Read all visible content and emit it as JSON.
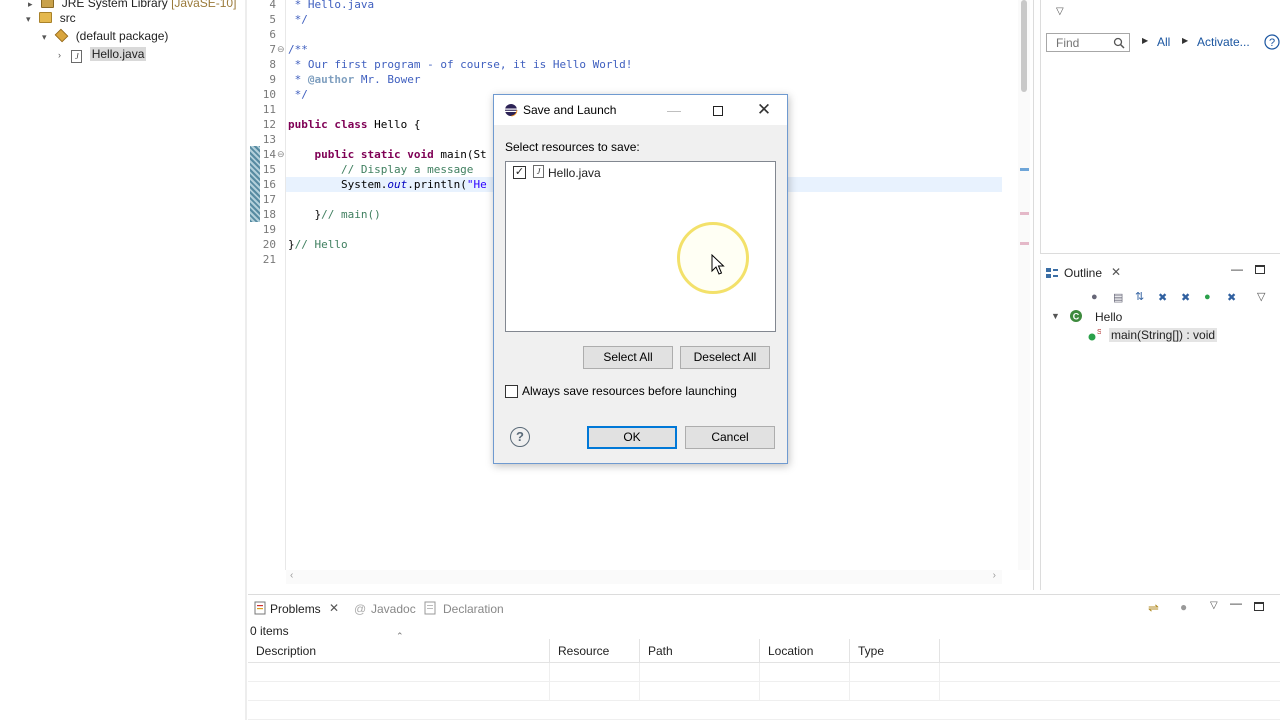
{
  "explorer": {
    "items": [
      {
        "label": "JRE System Library",
        "suffix": "[JavaSE-10]"
      },
      {
        "label": "src"
      },
      {
        "label": "(default package)"
      },
      {
        "label": "Hello.java"
      }
    ]
  },
  "editor": {
    "lines": [
      {
        "n": "4",
        "text": " * Hello.java"
      },
      {
        "n": "5",
        "text": " */"
      },
      {
        "n": "6",
        "text": ""
      },
      {
        "n": "7",
        "text": "/**"
      },
      {
        "n": "8",
        "text": " * Our first program - of course, it is Hello World!"
      },
      {
        "n": "9",
        "text": " * @author Mr. Bower"
      },
      {
        "n": "10",
        "text": " */"
      },
      {
        "n": "11",
        "text": ""
      },
      {
        "n": "12",
        "text": "public class Hello {"
      },
      {
        "n": "13",
        "text": ""
      },
      {
        "n": "14",
        "text": "    public static void main(St"
      },
      {
        "n": "15",
        "text": "        // Display a message"
      },
      {
        "n": "16",
        "text": "        System.out.println(\"He"
      },
      {
        "n": "17",
        "text": ""
      },
      {
        "n": "18",
        "text": "    }// main()"
      },
      {
        "n": "19",
        "text": ""
      },
      {
        "n": "20",
        "text": "}// Hello"
      },
      {
        "n": "21",
        "text": ""
      }
    ],
    "code": {
      "l4": " * Hello.java",
      "l5": " */",
      "l7": "/**",
      "l8": " * Our first program - of course, it is Hello World!",
      "l9a": " * ",
      "l9b": "@author",
      "l9c": " Mr. Bower",
      "l10": " */",
      "l12kw": "public class",
      "l12rest": " Hello {",
      "l14kw": "    public static void",
      "l14rest": " main(St",
      "l15": "        // Display a message",
      "l16a": "        System.",
      "l16b": "out",
      "l16c": ".println(",
      "l16d": "\"He",
      "l18a": "    }",
      "l18b": "// main()",
      "l20a": "}",
      "l20b": "// Hello"
    }
  },
  "right_top": {
    "find_placeholder": "Find",
    "all_label": "All",
    "activate_label": "Activate..."
  },
  "outline": {
    "tab_label": "Outline",
    "class_name": "Hello",
    "method_label": "main(String[]) : void"
  },
  "problems": {
    "tabs": {
      "problems": "Problems",
      "javadoc": "Javadoc",
      "declaration": "Declaration"
    },
    "count_text": "0 items",
    "columns": [
      "Description",
      "Resource",
      "Path",
      "Location",
      "Type"
    ]
  },
  "dialog": {
    "title": "Save and Launch",
    "select_label": "Select resources to save:",
    "resource_item": "Hello.java",
    "select_all": "Select All",
    "deselect_all": "Deselect All",
    "always_save": "Always save resources before launching",
    "ok": "OK",
    "cancel": "Cancel",
    "help": "?"
  },
  "colors": {
    "accent": "#0078d7",
    "comment": "#3f5fbf",
    "keyword": "#7f0055"
  }
}
